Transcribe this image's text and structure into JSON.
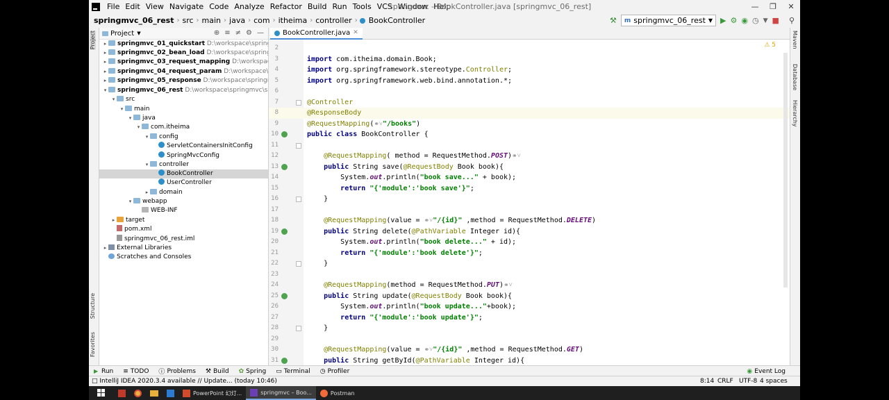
{
  "menubar": {
    "items": [
      "File",
      "Edit",
      "View",
      "Navigate",
      "Code",
      "Analyze",
      "Refactor",
      "Build",
      "Run",
      "Tools",
      "VCS",
      "Window",
      "Help"
    ],
    "window_title": "springmvc - BookController.java [springmvc_06_rest]"
  },
  "navbar": {
    "crumbs": [
      "springmvc_06_rest",
      "src",
      "main",
      "java",
      "com",
      "itheima",
      "controller",
      "BookController"
    ],
    "run_config": "springmvc_06_rest"
  },
  "project": {
    "title": "Project",
    "rows": [
      {
        "arrow": "▸",
        "icon": "folder",
        "name": "springmvc_01_quickstart",
        "path": "D:\\workspace\\springmvc\\",
        "bold": true
      },
      {
        "arrow": "▸",
        "icon": "folder",
        "name": "springmvc_02_bean_load",
        "path": "D:\\workspace\\springmvc\\",
        "bold": true
      },
      {
        "arrow": "▸",
        "icon": "folder",
        "name": "springmvc_03_request_mapping",
        "path": "D:\\workspace\\spri",
        "bold": true
      },
      {
        "arrow": "▸",
        "icon": "folder",
        "name": "springmvc_04_request_param",
        "path": "D:\\workspace\\spring",
        "bold": true
      },
      {
        "arrow": "▸",
        "icon": "folder",
        "name": "springmvc_05_response",
        "path": "D:\\workspace\\springmvc\\s",
        "bold": true
      },
      {
        "arrow": "▾",
        "icon": "folder",
        "name": "springmvc_06_rest",
        "path": "D:\\workspace\\springmvc\\springr",
        "bold": true
      },
      {
        "arrow": "▾",
        "icon": "folder",
        "name": "src",
        "path": "",
        "bold": false
      },
      {
        "arrow": "▾",
        "icon": "folder",
        "name": "main",
        "path": "",
        "bold": false
      },
      {
        "arrow": "▾",
        "icon": "folder",
        "name": "java",
        "path": "",
        "bold": false
      },
      {
        "arrow": "▾",
        "icon": "folder",
        "name": "com.itheima",
        "path": "",
        "bold": false
      },
      {
        "arrow": "▾",
        "icon": "folder",
        "name": "config",
        "path": "",
        "bold": false
      },
      {
        "arrow": "",
        "icon": "class",
        "name": "ServletContainersInitConfig",
        "path": "",
        "bold": false
      },
      {
        "arrow": "",
        "icon": "class",
        "name": "SpringMvcConfig",
        "path": "",
        "bold": false
      },
      {
        "arrow": "▾",
        "icon": "folder",
        "name": "controller",
        "path": "",
        "bold": false
      },
      {
        "arrow": "",
        "icon": "class",
        "name": "BookController",
        "path": "",
        "bold": false
      },
      {
        "arrow": "",
        "icon": "class",
        "name": "UserController",
        "path": "",
        "bold": false
      },
      {
        "arrow": "▸",
        "icon": "folder",
        "name": "domain",
        "path": "",
        "bold": false
      },
      {
        "arrow": "▾",
        "icon": "folder",
        "name": "webapp",
        "path": "",
        "bold": false
      },
      {
        "arrow": "",
        "icon": "folder-gray",
        "name": "WEB-INF",
        "path": "",
        "bold": false
      },
      {
        "arrow": "▸",
        "icon": "folder-orange",
        "name": "target",
        "path": "",
        "bold": false
      },
      {
        "arrow": "",
        "icon": "maven",
        "name": "pom.xml",
        "path": "",
        "bold": false
      },
      {
        "arrow": "",
        "icon": "file",
        "name": "springmvc_06_rest.iml",
        "path": "",
        "bold": false
      },
      {
        "arrow": "▸",
        "icon": "lib",
        "name": "External Libraries",
        "path": "",
        "bold": false
      },
      {
        "arrow": "",
        "icon": "scratch",
        "name": "Scratches and Consoles",
        "path": "",
        "bold": false
      }
    ]
  },
  "editor": {
    "tab": "BookController.java",
    "warnings": "5",
    "lines": [
      {
        "n": "2",
        "html": ""
      },
      {
        "n": "3",
        "html": "<span class='kw'>import</span> com.itheima.domain.Book;"
      },
      {
        "n": "4",
        "html": "<span class='kw'>import</span> org.springframework.stereotype.<span class='an'>Controller</span>;"
      },
      {
        "n": "5",
        "html": "<span class='kw'>import</span> org.springframework.web.bind.annotation.*;"
      },
      {
        "n": "6",
        "html": ""
      },
      {
        "n": "7",
        "html": "<span class='an'>@Controller</span>"
      },
      {
        "n": "8",
        "html": "<span class='an'>@ResponseBody</span>"
      },
      {
        "n": "9",
        "html": "<span class='an'>@RequestMapping</span>(<span class='ic'>&#9901;&#709;</span><span class='st'>\"/books\"</span>)"
      },
      {
        "n": "10",
        "html": "<span class='kw'>public class</span> BookController {"
      },
      {
        "n": "11",
        "html": ""
      },
      {
        "n": "12",
        "html": "    <span class='an'>@RequestMapping</span>( method = RequestMethod.<span class='it'>POST</span>)<span class='ic'>&#9901;&#709;</span>"
      },
      {
        "n": "13",
        "html": "    <span class='kw'>public</span> String save(<span class='an'>@RequestBody</span> Book book){"
      },
      {
        "n": "14",
        "html": "        System.<span class='it'>out</span>.println(<span class='st'>\"book save...\"</span> + book);"
      },
      {
        "n": "15",
        "html": "        <span class='kw'>return</span> <span class='st'>\"{'module':'book save'}\"</span>;"
      },
      {
        "n": "16",
        "html": "    }"
      },
      {
        "n": "17",
        "html": ""
      },
      {
        "n": "18",
        "html": "    <span class='an'>@RequestMapping</span>(value = <span class='ic'>&#9901;&#709;</span><span class='st'>\"/{id}\"</span> ,method = RequestMethod.<span class='it'>DELETE</span>)"
      },
      {
        "n": "19",
        "html": "    <span class='kw'>public</span> String delete(<span class='an'>@PathVariable</span> Integer id){"
      },
      {
        "n": "20",
        "html": "        System.<span class='it'>out</span>.println(<span class='st'>\"book delete...\"</span> + id);"
      },
      {
        "n": "21",
        "html": "        <span class='kw'>return</span> <span class='st'>\"{'module':'book delete'}\"</span>;"
      },
      {
        "n": "22",
        "html": "    }"
      },
      {
        "n": "23",
        "html": ""
      },
      {
        "n": "24",
        "html": "    <span class='an'>@RequestMapping</span>(method = RequestMethod.<span class='it'>PUT</span>)<span class='ic'>&#9901;&#709;</span>"
      },
      {
        "n": "25",
        "html": "    <span class='kw'>public</span> String update(<span class='an'>@RequestBody</span> Book book){"
      },
      {
        "n": "26",
        "html": "        System.<span class='it'>out</span>.println(<span class='st'>\"book update...\"</span>+book);"
      },
      {
        "n": "27",
        "html": "        <span class='kw'>return</span> <span class='st'>\"{'module':'book update'}\"</span>;"
      },
      {
        "n": "28",
        "html": "    }"
      },
      {
        "n": "29",
        "html": ""
      },
      {
        "n": "30",
        "html": "    <span class='an'>@RequestMapping</span>(value = <span class='ic'>&#9901;&#709;</span><span class='st'>\"/{id}\"</span> ,method = RequestMethod.<span class='it'>GET</span>)"
      },
      {
        "n": "31",
        "html": "    <span class='kw'>public</span> String getById(<span class='an'>@PathVariable</span> Integer id){"
      }
    ]
  },
  "bottombar": {
    "tools": [
      "Run",
      "TODO",
      "Problems",
      "Build",
      "Spring",
      "Terminal",
      "Profiler"
    ],
    "event_log": "Event Log"
  },
  "status": {
    "message": "IntelliJ IDEA 2020.3.4 available // Update... (today 10:46)",
    "position": "8:14",
    "line_sep": "CRLF",
    "encoding": "UTF-8",
    "indent": "4 spaces"
  },
  "taskbar": {
    "apps": [
      "PowerPoint 幻灯...",
      "springmvc – Boo...",
      "Postman"
    ]
  },
  "side_tabs": {
    "left": [
      "Project",
      "Structure",
      "Favorites"
    ],
    "right": [
      "Maven",
      "Database",
      "Hierarchy"
    ]
  }
}
